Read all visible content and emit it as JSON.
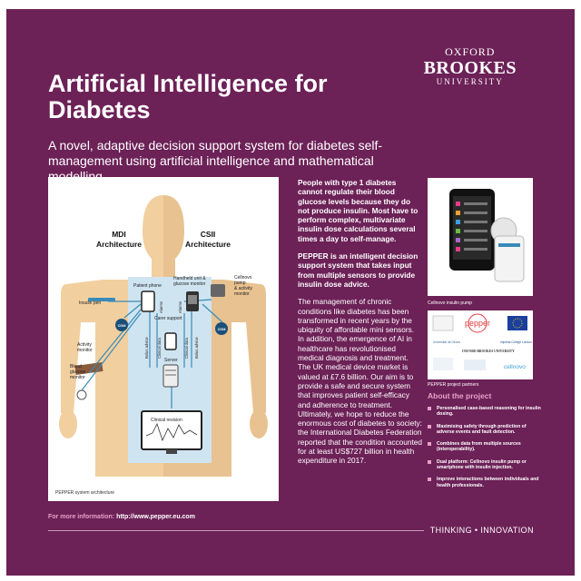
{
  "logo": {
    "line1": "OXFORD",
    "line2": "BROOKES",
    "line3": "UNIVERSITY"
  },
  "title": "Artificial Intelligence for Diabetes",
  "subtitle": "A novel, adaptive decision support system for diabetes self-management using artificial intelligence and mathematical modelling.",
  "figure": {
    "mdi": "MDI",
    "csii": "CSII",
    "architecture": "Architecture",
    "patient_phone": "Patient phone",
    "handheld_1": "Handheld unit &",
    "handheld_2": "glucose monitor",
    "cellnovo_1": "Cellnovo",
    "cellnovo_2": "pump",
    "cellnovo_3": "& activity",
    "cellnovo_4": "monitor",
    "insulin_pen": "Insulin pen",
    "cgm": "CGM",
    "activity_1": "Activity",
    "activity_2": "monitor",
    "blood_1": "Blood",
    "blood_2": "glucose",
    "blood_3": "monitor",
    "alarms": "Alarms",
    "carer_support": "Carer support",
    "bolus_advice": "Bolus advice",
    "clinical_data": "Clinical data",
    "server": "Server",
    "clinical_revision": "Clinical revision",
    "caption": "PEPPER system architecture"
  },
  "body": {
    "p1": "People with type 1 diabetes cannot regulate their blood glucose levels because they do not produce insulin. Most have to perform complex, multivariate insulin dose calculations several times a day to self-manage.",
    "p2": "PEPPER is an intelligent decision support system that takes input from multiple sensors to provide insulin dose advice.",
    "p3": "The management of chronic conditions like diabetes has been transformed in recent years by the ubiquity of affordable mini sensors. In addition, the emergence of AI in healthcare has revolutionised medical diagnosis and treatment. The UK medical device market is valued at £7.6 billion. Our aim is to provide a safe and secure system that improves patient self-efficacy and adherence to treatment. Ultimately, we hope to reduce the enormous cost of diabetes to society: the International Diabetes Federation reported that the condition accounted for at least US$727 billion in health expenditure in 2017."
  },
  "pump_caption": "Cellnovo insulin pump",
  "partners": {
    "caption": "PEPPER project partners",
    "pepper": "pepper",
    "girona": "Universitat de Girona",
    "brookes": "OXFORD BROOKES UNIVERSITY",
    "imperial": "Imperial College London",
    "cellnovo": "cellnovo"
  },
  "about": {
    "title": "About the project",
    "items": [
      "Personalised case-based reasoning for insulin dosing.",
      "Maximising safety through prediction of adverse events and fault detection.",
      "Combines data from multiple sources (interoperability).",
      "Dual platform: Cellnovo insulin pump or smartphone with insulin injection.",
      "Improve interactions between individuals and health professionals."
    ]
  },
  "more": {
    "label": "For more information:",
    "url": "http://www.pepper.eu.com"
  },
  "tagline": "THINKING • INNOVATION",
  "colors": {
    "background": "#6c2157",
    "accent": "#e8a0c8",
    "skin": "#f2cf9f",
    "blue": "#cfe4f1",
    "cgm": "#1b4f79"
  }
}
